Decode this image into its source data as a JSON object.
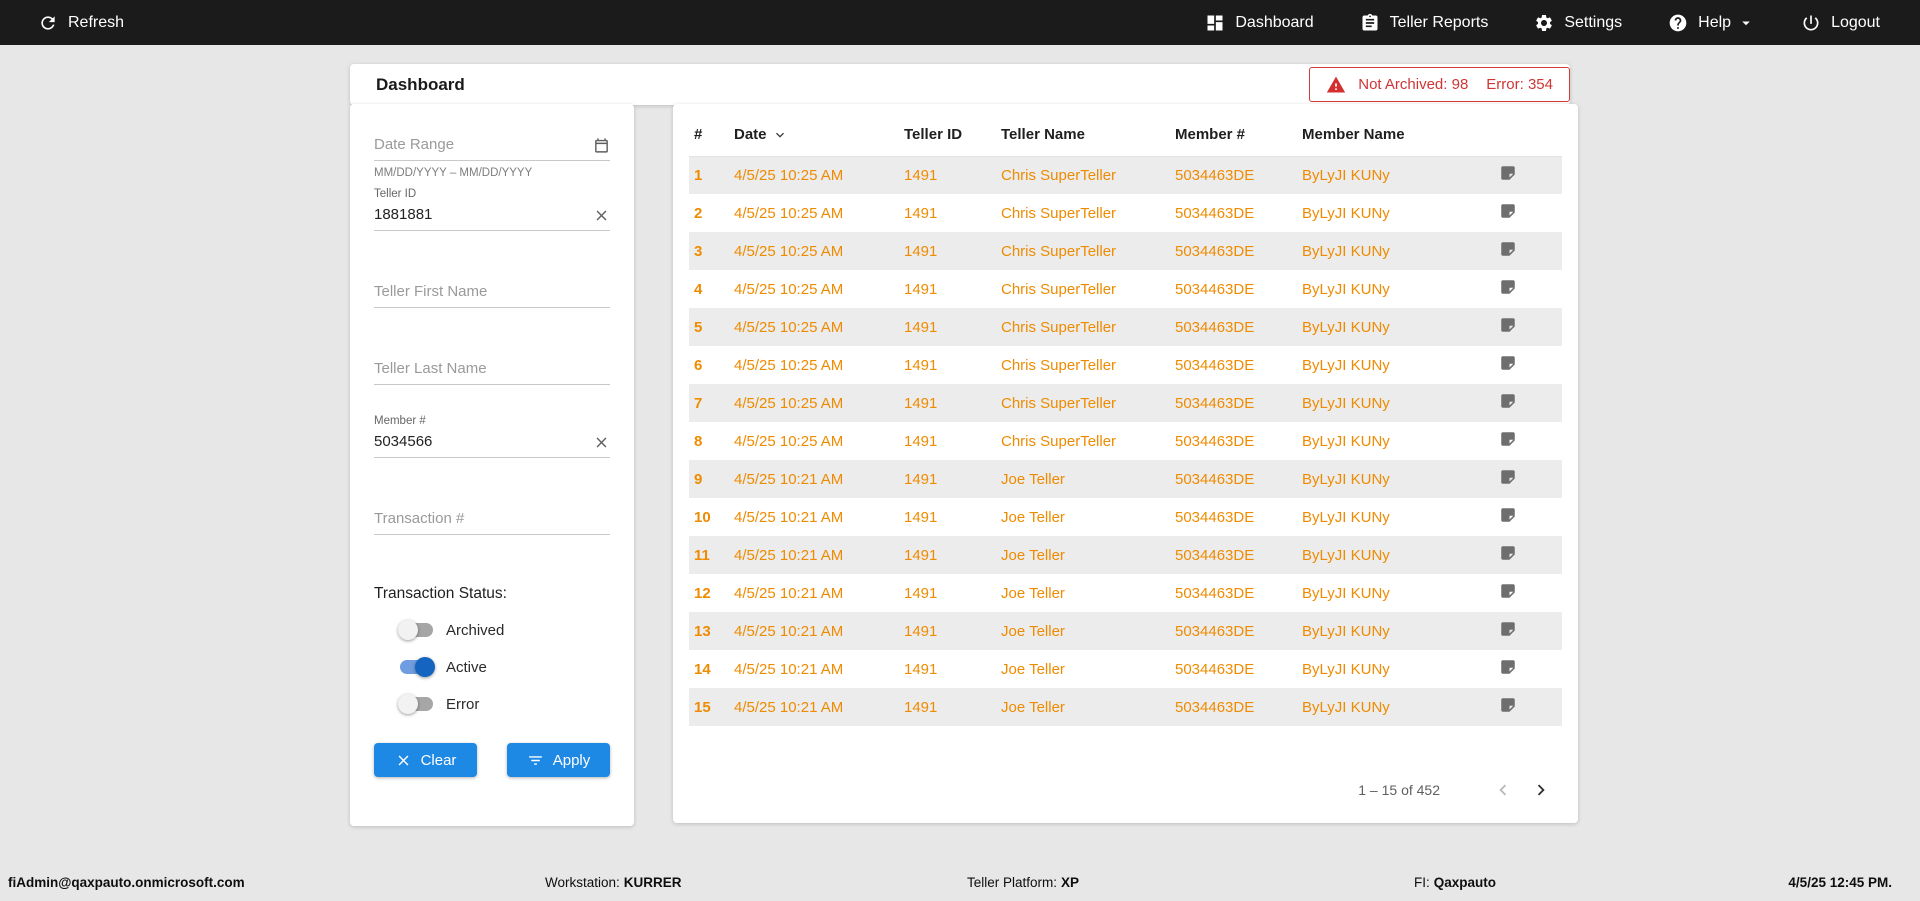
{
  "colors": {
    "navbar_bg": "#1b1b1b",
    "accent_blue": "#1e88e5",
    "data_orange": "#ef8b00",
    "alert_red": "#d32f2f",
    "toggle_on_blue": "#1565c0"
  },
  "navbar": {
    "refresh_label": "Refresh",
    "items": [
      {
        "label": "Dashboard",
        "icon": "dashboard-icon"
      },
      {
        "label": "Teller Reports",
        "icon": "reports-icon"
      },
      {
        "label": "Settings",
        "icon": "gear-icon"
      },
      {
        "label": "Help",
        "icon": "help-icon"
      },
      {
        "label": "Logout",
        "icon": "power-icon"
      }
    ]
  },
  "header": {
    "title": "Dashboard",
    "alert": {
      "not_archived": "Not Archived: 98",
      "error": "Error: 354"
    }
  },
  "filters": {
    "date_range": {
      "placeholder": "Date Range",
      "hint": "MM/DD/YYYY – MM/DD/YYYY"
    },
    "teller_id": {
      "label": "Teller ID",
      "value": "1881881"
    },
    "teller_first_name": {
      "placeholder": "Teller First Name"
    },
    "teller_last_name": {
      "placeholder": "Teller Last Name"
    },
    "member_number": {
      "label": "Member #",
      "value": "5034566"
    },
    "transaction_number": {
      "placeholder": "Transaction #"
    },
    "status_label": "Transaction Status:",
    "status_toggles": [
      {
        "label": "Archived",
        "on": false
      },
      {
        "label": "Active",
        "on": true
      },
      {
        "label": "Error",
        "on": false
      }
    ],
    "clear_label": "Clear",
    "apply_label": "Apply"
  },
  "table": {
    "columns": {
      "num": "#",
      "date": "Date",
      "teller_id": "Teller ID",
      "teller_name": "Teller Name",
      "member_num": "Member #",
      "member_name": "Member Name"
    },
    "rows": [
      {
        "num": "1",
        "date": "4/5/25 10:25 AM",
        "teller_id": "1491",
        "teller_name": "Chris SuperTeller",
        "member_num": "5034463DE",
        "member_name": "ByLyJI KUNy"
      },
      {
        "num": "2",
        "date": "4/5/25 10:25 AM",
        "teller_id": "1491",
        "teller_name": "Chris SuperTeller",
        "member_num": "5034463DE",
        "member_name": "ByLyJI KUNy"
      },
      {
        "num": "3",
        "date": "4/5/25 10:25 AM",
        "teller_id": "1491",
        "teller_name": "Chris SuperTeller",
        "member_num": "5034463DE",
        "member_name": "ByLyJI KUNy"
      },
      {
        "num": "4",
        "date": "4/5/25 10:25 AM",
        "teller_id": "1491",
        "teller_name": "Chris SuperTeller",
        "member_num": "5034463DE",
        "member_name": "ByLyJI KUNy"
      },
      {
        "num": "5",
        "date": "4/5/25 10:25 AM",
        "teller_id": "1491",
        "teller_name": "Chris SuperTeller",
        "member_num": "5034463DE",
        "member_name": "ByLyJI KUNy"
      },
      {
        "num": "6",
        "date": "4/5/25 10:25 AM",
        "teller_id": "1491",
        "teller_name": "Chris SuperTeller",
        "member_num": "5034463DE",
        "member_name": "ByLyJI KUNy"
      },
      {
        "num": "7",
        "date": "4/5/25 10:25 AM",
        "teller_id": "1491",
        "teller_name": "Chris SuperTeller",
        "member_num": "5034463DE",
        "member_name": "ByLyJI KUNy"
      },
      {
        "num": "8",
        "date": "4/5/25 10:25 AM",
        "teller_id": "1491",
        "teller_name": "Chris SuperTeller",
        "member_num": "5034463DE",
        "member_name": "ByLyJI KUNy"
      },
      {
        "num": "9",
        "date": "4/5/25 10:21 AM",
        "teller_id": "1491",
        "teller_name": "Joe Teller",
        "member_num": "5034463DE",
        "member_name": "ByLyJI KUNy"
      },
      {
        "num": "10",
        "date": "4/5/25 10:21 AM",
        "teller_id": "1491",
        "teller_name": "Joe Teller",
        "member_num": "5034463DE",
        "member_name": "ByLyJI KUNy"
      },
      {
        "num": "11",
        "date": "4/5/25 10:21 AM",
        "teller_id": "1491",
        "teller_name": "Joe Teller",
        "member_num": "5034463DE",
        "member_name": "ByLyJI KUNy"
      },
      {
        "num": "12",
        "date": "4/5/25 10:21 AM",
        "teller_id": "1491",
        "teller_name": "Joe Teller",
        "member_num": "5034463DE",
        "member_name": "ByLyJI KUNy"
      },
      {
        "num": "13",
        "date": "4/5/25 10:21 AM",
        "teller_id": "1491",
        "teller_name": "Joe Teller",
        "member_num": "5034463DE",
        "member_name": "ByLyJI KUNy"
      },
      {
        "num": "14",
        "date": "4/5/25 10:21 AM",
        "teller_id": "1491",
        "teller_name": "Joe Teller",
        "member_num": "5034463DE",
        "member_name": "ByLyJI KUNy"
      },
      {
        "num": "15",
        "date": "4/5/25 10:21 AM",
        "teller_id": "1491",
        "teller_name": "Joe Teller",
        "member_num": "5034463DE",
        "member_name": "ByLyJI KUNy"
      }
    ],
    "pagination": {
      "range_text": "1 – 15 of 452"
    }
  },
  "footer": {
    "email": "fiAdmin@qaxpauto.onmicrosoft.com",
    "workstation_label": "Workstation:",
    "workstation_value": "KURRER",
    "platform_label": "Teller Platform:",
    "platform_value": "XP",
    "fi_label": "FI:",
    "fi_value": "Qaxpauto",
    "datetime": "4/5/25 12:45 PM."
  }
}
